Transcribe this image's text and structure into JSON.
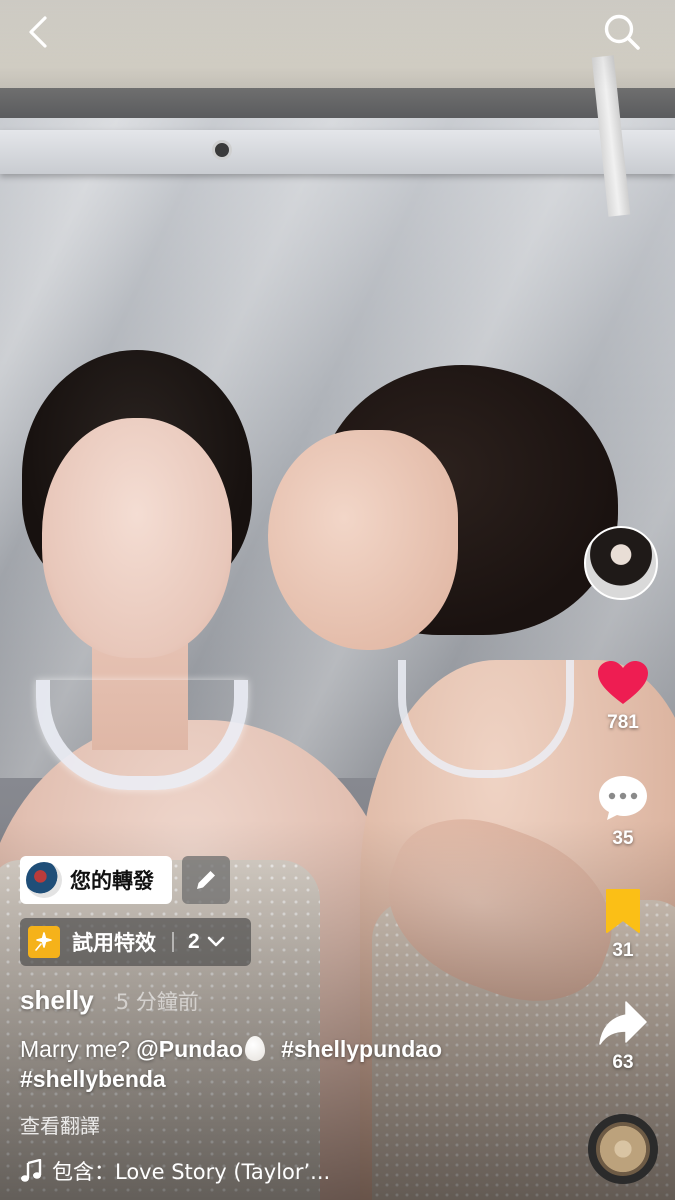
{
  "repost": {
    "label": "您的轉發"
  },
  "effect": {
    "label": "試用特效",
    "count": "2"
  },
  "post": {
    "username": "shelly",
    "time": "5 分鐘前",
    "caption_text_1": "Marry me? ",
    "mention": "@Pundao",
    "hashtag_1": "#shellypundao",
    "hashtag_2": "#shellybenda",
    "translate": "查看翻譯"
  },
  "actions": {
    "likes": "781",
    "comments": "35",
    "saves": "31",
    "shares": "63"
  },
  "music": {
    "label": "包含：Love Story (Taylor’..."
  },
  "colors": {
    "like_red": "#ee1d52",
    "save_yellow": "#fbbf16",
    "effect_yellow": "#f5b21a"
  },
  "icons": [
    "back-icon",
    "search-icon",
    "heart-icon",
    "comment-icon",
    "bookmark-icon",
    "share-icon",
    "music-note-icon",
    "pencil-icon",
    "sparkle-icon",
    "chevron-down-icon"
  ]
}
